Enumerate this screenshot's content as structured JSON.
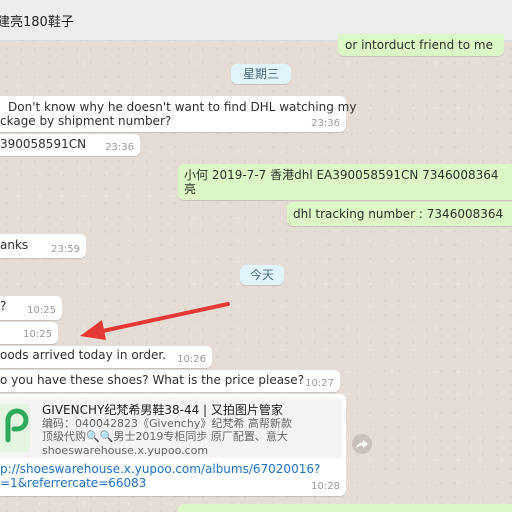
{
  "header": {
    "contact_name": "建亮180鞋子"
  },
  "date_dividers": {
    "day1": "星期三",
    "today": "今天"
  },
  "messages": {
    "m0": {
      "text": "or intorduct friend to me"
    },
    "m1": {
      "line1": "Don't know why he doesn't want to find DHL watching my",
      "line2": "ckage by shipment number?",
      "time": "23:36"
    },
    "m2": {
      "text": "390058591CN",
      "time": "23:36"
    },
    "m3": {
      "line1": "小何 2019-7-7 香港dhl    EA390058591CN      7346008364",
      "line2": "亮"
    },
    "m4": {
      "text": "dhl tracking number : 7346008364"
    },
    "m5": {
      "text": "anks",
      "time": "23:59"
    },
    "m6": {
      "text": "?",
      "time": "10:25"
    },
    "m7": {
      "time": "10:25"
    },
    "m8": {
      "text": "oods arrived today in order.",
      "time": "10:26"
    },
    "m9": {
      "text": "o you have these shoes?  What is the price please?",
      "time": "10:27"
    },
    "m10": {
      "preview_title": "GIVENCHY纪梵希男鞋38-44 | 又拍图片管家",
      "preview_desc1": "编码：040042823《Givenchy》纪梵希 高帮新款",
      "preview_desc2": "顶级代购🔍🔍男士2019专柜同步 原厂配置、意大",
      "preview_domain": "shoeswarehouse.x.yupoo.com",
      "url1": "p://shoeswarehouse.x.yupoo.com/albums/67020016?",
      "url2": "=1&referrercate=66083",
      "time": "10:28"
    }
  },
  "colors": {
    "incoming": "#ffffff",
    "outgoing": "#dcf8c6",
    "annotation_arrow": "#e53935",
    "link": "#1a73c6"
  },
  "icons": {
    "forward": "forward-icon",
    "preview_logo": "yupoo-logo-icon"
  }
}
